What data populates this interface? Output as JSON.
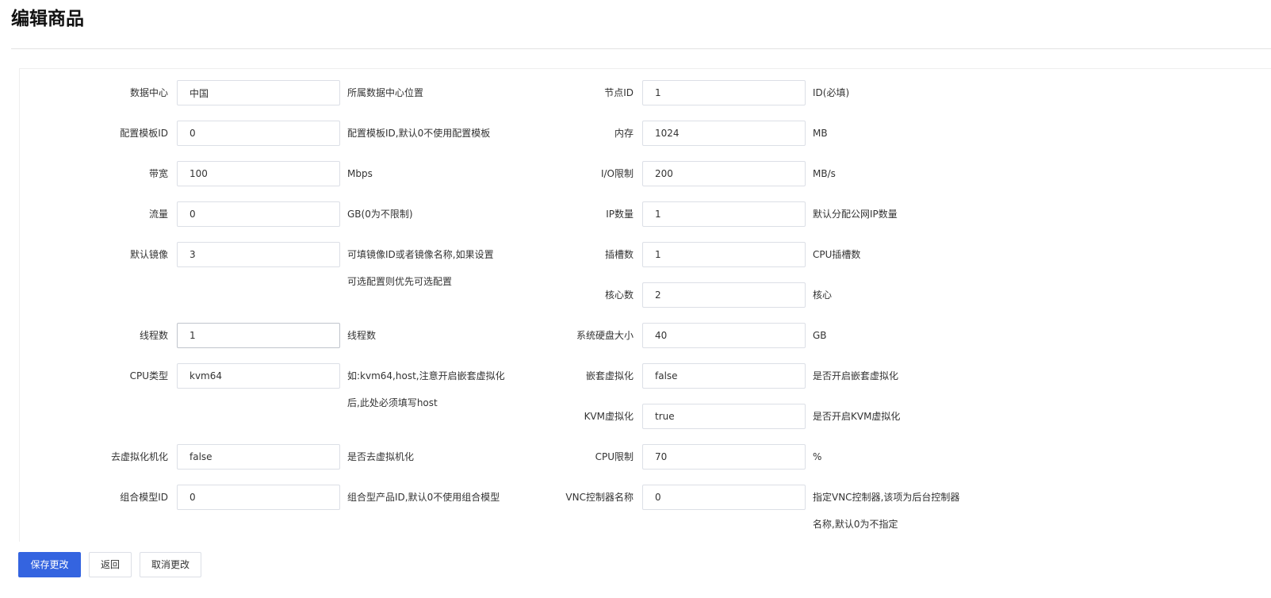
{
  "page": {
    "title": "编辑商品"
  },
  "form": {
    "left": [
      {
        "label": "数据中心",
        "value": "中国",
        "hint": [
          "所属数据中心位置"
        ]
      },
      {
        "label": "配置模板ID",
        "value": "0",
        "hint": [
          "配置模板ID,默认0不使用配置模板"
        ]
      },
      {
        "label": "带宽",
        "value": "100",
        "hint": [
          "Mbps"
        ]
      },
      {
        "label": "流量",
        "value": "0",
        "hint": [
          "GB(0为不限制)"
        ]
      },
      {
        "label": "默认镜像",
        "value": "3",
        "hint": [
          "可填镜像ID或者镜像名称,如果设置",
          "可选配置则优先可选配置"
        ]
      },
      {
        "label": "线程数",
        "value": "1",
        "hint": [
          "线程数"
        ]
      },
      {
        "label": "CPU类型",
        "value": "kvm64",
        "hint": [
          "如:kvm64,host,注意开启嵌套虚拟化",
          "后,此处必须填写host"
        ]
      },
      {
        "label": "去虚拟化机化",
        "value": "false",
        "hint": [
          "是否去虚拟机化"
        ]
      },
      {
        "label": "组合模型ID",
        "value": "0",
        "hint": [
          "组合型产品ID,默认0不使用组合模型"
        ]
      }
    ],
    "right": [
      {
        "label": "节点ID",
        "value": "1",
        "hint": [
          "ID(必填)"
        ]
      },
      {
        "label": "内存",
        "value": "1024",
        "hint": [
          "MB"
        ]
      },
      {
        "label": "I/O限制",
        "value": "200",
        "hint": [
          "MB/s"
        ]
      },
      {
        "label": "IP数量",
        "value": "1",
        "hint": [
          "默认分配公网IP数量"
        ]
      },
      {
        "label": "插槽数",
        "value": "1",
        "hint": [
          "CPU插槽数"
        ]
      },
      {
        "label": "核心数",
        "value": "2",
        "hint": [
          "核心"
        ]
      },
      {
        "label": "系统硬盘大小",
        "value": "40",
        "hint": [
          "GB"
        ]
      },
      {
        "label": "嵌套虚拟化",
        "value": "false",
        "hint": [
          "是否开启嵌套虚拟化"
        ]
      },
      {
        "label": "KVM虚拟化",
        "value": "true",
        "hint": [
          "是否开启KVM虚拟化"
        ]
      },
      {
        "label": "CPU限制",
        "value": "70",
        "hint": [
          "%"
        ]
      },
      {
        "label": "VNC控制器名称",
        "value": "0",
        "hint": [
          "指定VNC控制器,该项为后台控制器",
          "名称,默认0为不指定"
        ]
      }
    ]
  },
  "footer": {
    "save_label": "保存更改",
    "back_label": "返回",
    "cancel_label": "取消更改"
  }
}
